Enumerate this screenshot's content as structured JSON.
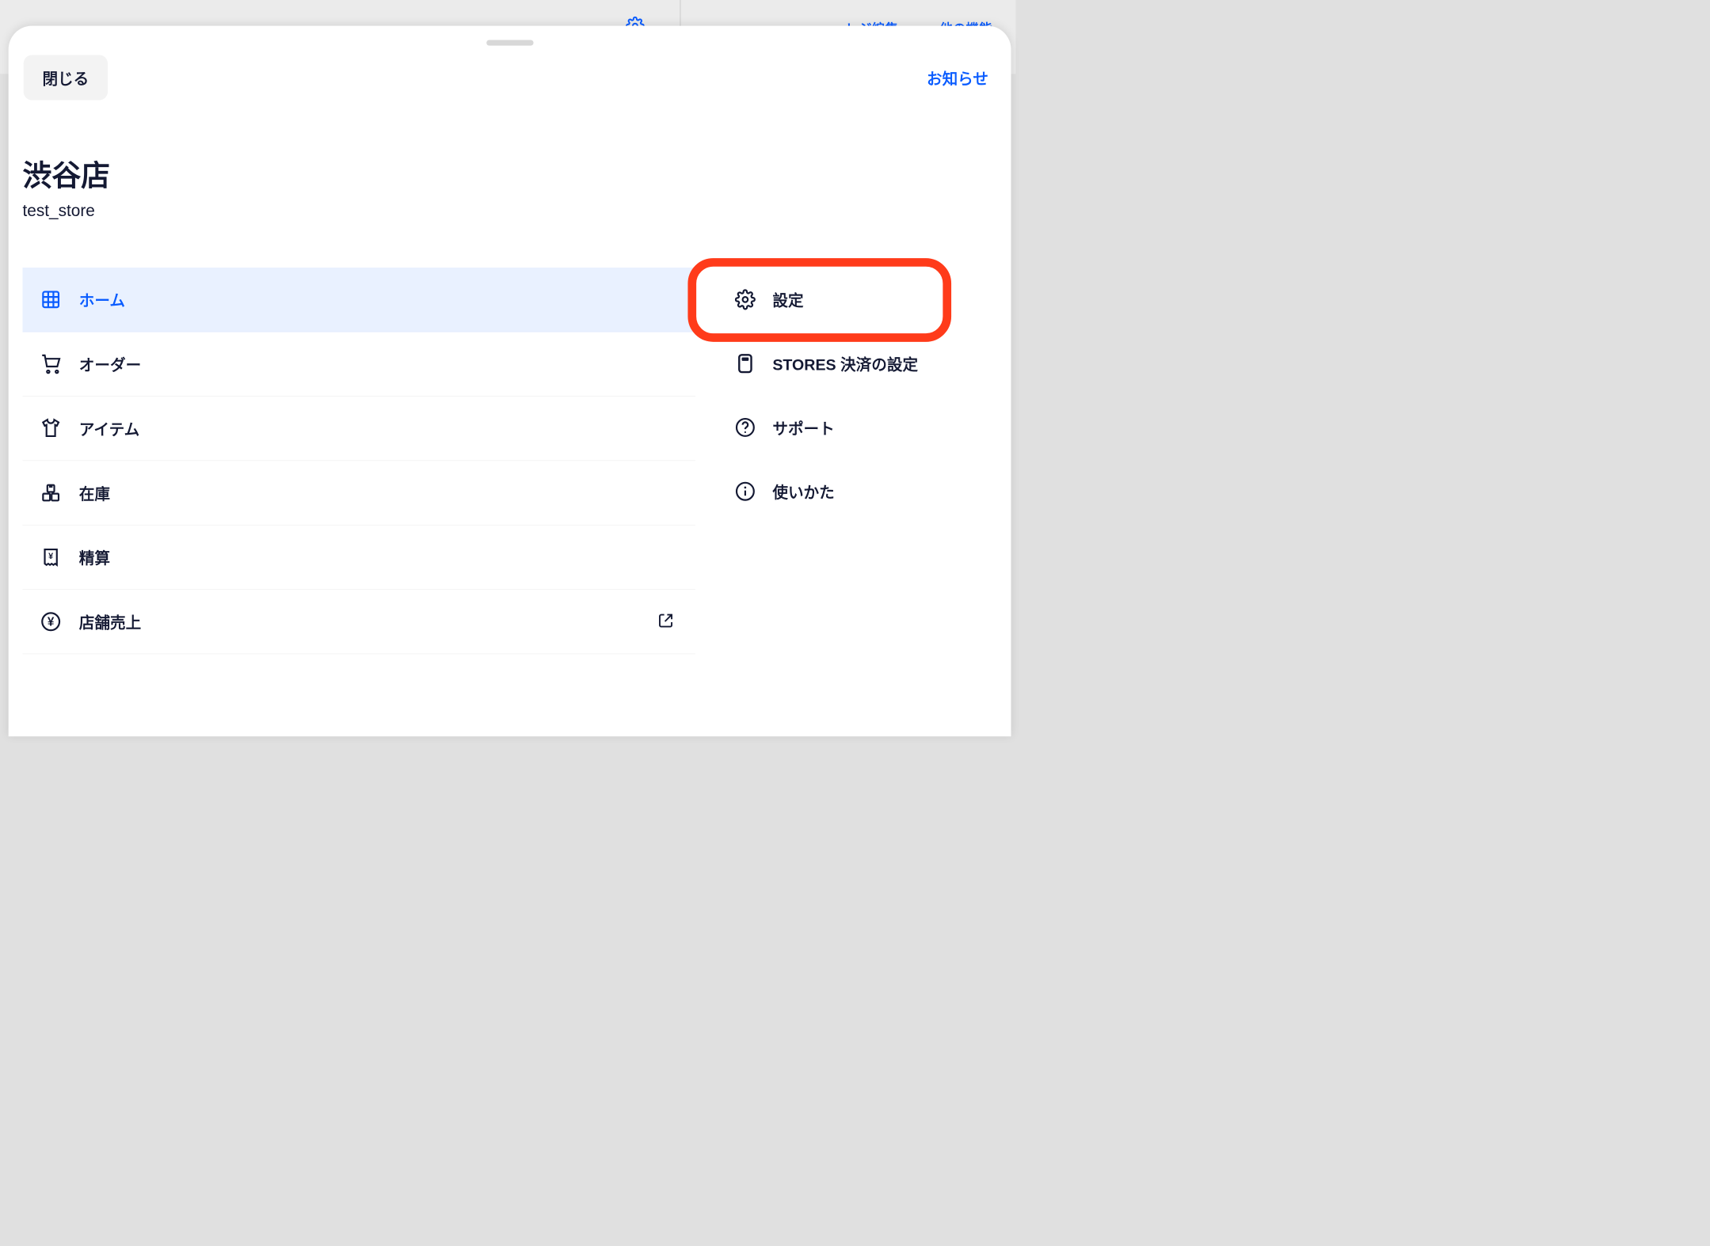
{
  "backdrop": {
    "edit_label": "レジ編集",
    "other_label": "他の機能"
  },
  "topbar": {
    "close_label": "閉じる",
    "notice_label": "お知らせ"
  },
  "store": {
    "name": "渋谷店",
    "subtitle": "test_store"
  },
  "main_nav": [
    {
      "key": "home",
      "label": "ホーム",
      "icon": "grid",
      "active": true
    },
    {
      "key": "order",
      "label": "オーダー",
      "icon": "cart",
      "active": false
    },
    {
      "key": "item",
      "label": "アイテム",
      "icon": "shirt",
      "active": false
    },
    {
      "key": "stock",
      "label": "在庫",
      "icon": "boxes",
      "active": false
    },
    {
      "key": "settlement",
      "label": "精算",
      "icon": "receipt",
      "active": false
    },
    {
      "key": "sales",
      "label": "店舗売上",
      "icon": "yen",
      "active": false,
      "external": true
    }
  ],
  "side_nav": [
    {
      "key": "settings",
      "label": "設定",
      "icon": "gear",
      "highlighted": true
    },
    {
      "key": "payment_settings",
      "label": "STORES 決済の設定",
      "icon": "device"
    },
    {
      "key": "support",
      "label": "サポート",
      "icon": "help"
    },
    {
      "key": "howto",
      "label": "使いかた",
      "icon": "info"
    }
  ],
  "highlight": {
    "target": "settings"
  }
}
